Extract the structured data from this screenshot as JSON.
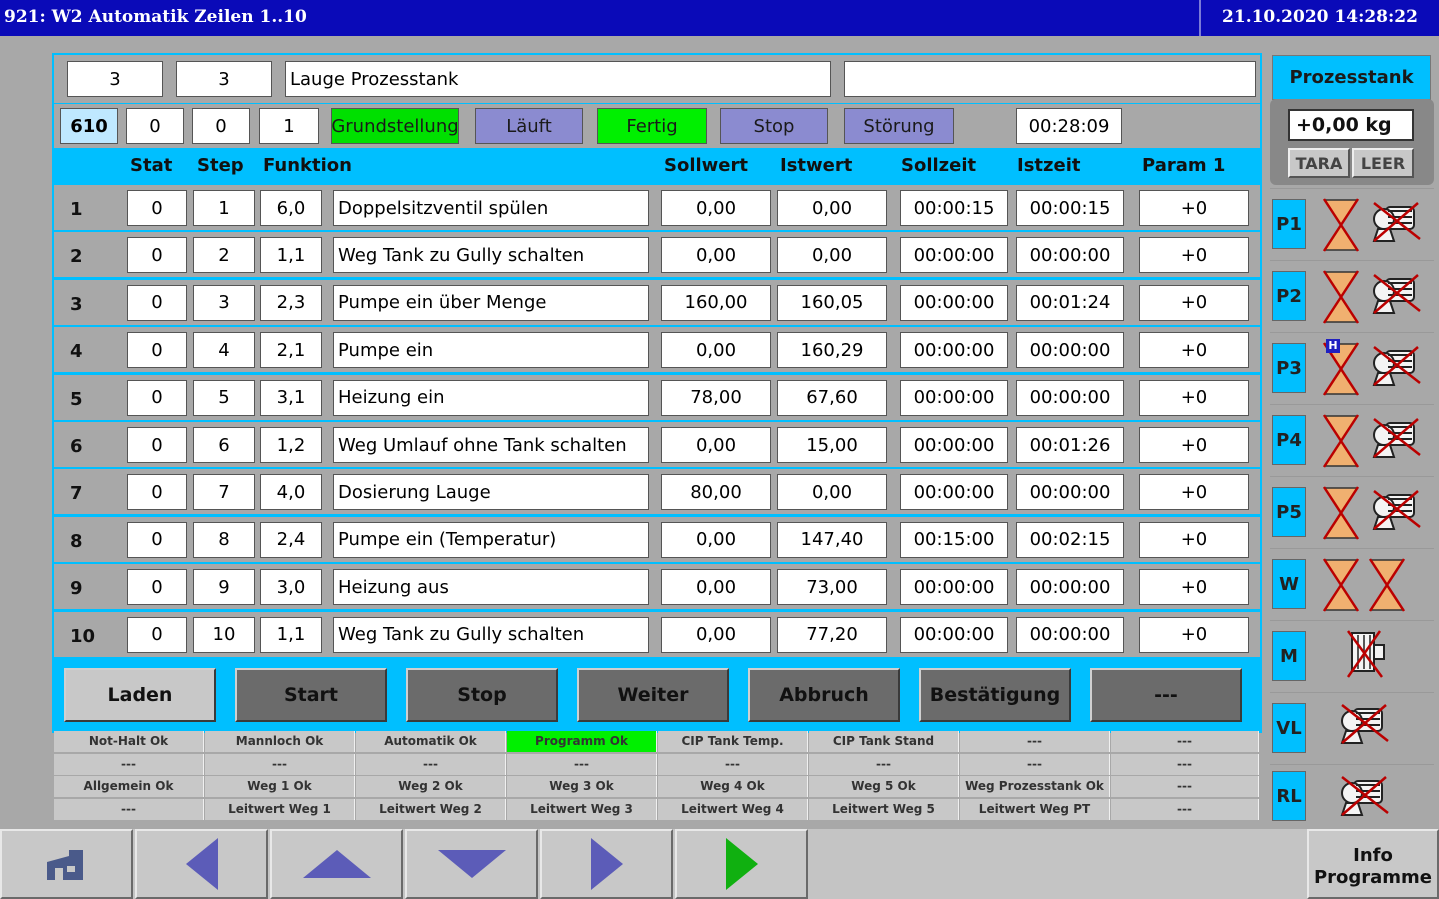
{
  "titlebar": {
    "title": "921: W2 Automatik Zeilen 1..10",
    "datetime": "21.10.2020 14:28:22"
  },
  "header": {
    "field1": "3",
    "field2": "3",
    "name": "Lauge Prozesstank",
    "extra": "",
    "program_no": "610",
    "v1": "0",
    "v2": "0",
    "v3": "1",
    "status_buttons": [
      {
        "label": "Grundstellung",
        "color": "#00e000"
      },
      {
        "label": "Läuft",
        "color": "#8b8bd0"
      },
      {
        "label": "Fertig",
        "color": "#00f000"
      },
      {
        "label": "Stop",
        "color": "#8b8bd0"
      },
      {
        "label": "Störung",
        "color": "#8b8bd0"
      }
    ],
    "runtime": "00:28:09"
  },
  "columns": {
    "stat": "Stat",
    "step": "Step",
    "funktion": "Funktion",
    "sollwert": "Sollwert",
    "istwert": "Istwert",
    "sollzeit": "Sollzeit",
    "istzeit": "Istzeit",
    "param1": "Param 1"
  },
  "rows": [
    {
      "num": "1",
      "stat": "0",
      "step": "1",
      "code": "6,0",
      "func": "Doppelsitzventil spülen",
      "soll": "0,00",
      "ist": "0,00",
      "sollzeit": "00:00:15",
      "istzeit": "00:00:15",
      "param": "+0"
    },
    {
      "num": "2",
      "stat": "0",
      "step": "2",
      "code": "1,1",
      "func": "Weg Tank zu Gully schalten",
      "soll": "0,00",
      "ist": "0,00",
      "sollzeit": "00:00:00",
      "istzeit": "00:00:00",
      "param": "+0"
    },
    {
      "num": "3",
      "stat": "0",
      "step": "3",
      "code": "2,3",
      "func": "Pumpe ein über Menge",
      "soll": "160,00",
      "ist": "160,05",
      "sollzeit": "00:00:00",
      "istzeit": "00:01:24",
      "param": "+0"
    },
    {
      "num": "4",
      "stat": "0",
      "step": "4",
      "code": "2,1",
      "func": "Pumpe ein",
      "soll": "0,00",
      "ist": "160,29",
      "sollzeit": "00:00:00",
      "istzeit": "00:00:00",
      "param": "+0"
    },
    {
      "num": "5",
      "stat": "0",
      "step": "5",
      "code": "3,1",
      "func": "Heizung ein",
      "soll": "78,00",
      "ist": "67,60",
      "sollzeit": "00:00:00",
      "istzeit": "00:00:00",
      "param": "+0"
    },
    {
      "num": "6",
      "stat": "0",
      "step": "6",
      "code": "1,2",
      "func": "Weg Umlauf ohne Tank schalten",
      "soll": "0,00",
      "ist": "15,00",
      "sollzeit": "00:00:00",
      "istzeit": "00:01:26",
      "param": "+0"
    },
    {
      "num": "7",
      "stat": "0",
      "step": "7",
      "code": "4,0",
      "func": "Dosierung Lauge",
      "soll": "80,00",
      "ist": "0,00",
      "sollzeit": "00:00:00",
      "istzeit": "00:00:00",
      "param": "+0"
    },
    {
      "num": "8",
      "stat": "0",
      "step": "8",
      "code": "2,4",
      "func": "Pumpe ein (Temperatur)",
      "soll": "0,00",
      "ist": "147,40",
      "sollzeit": "00:15:00",
      "istzeit": "00:02:15",
      "param": "+0"
    },
    {
      "num": "9",
      "stat": "0",
      "step": "9",
      "code": "3,0",
      "func": "Heizung aus",
      "soll": "0,00",
      "ist": "73,00",
      "sollzeit": "00:00:00",
      "istzeit": "00:00:00",
      "param": "+0"
    },
    {
      "num": "10",
      "stat": "0",
      "step": "10",
      "code": "1,1",
      "func": "Weg Tank zu Gully schalten",
      "soll": "0,00",
      "ist": "77,20",
      "sollzeit": "00:00:00",
      "istzeit": "00:00:00",
      "param": "+0"
    }
  ],
  "actions": [
    "Laden",
    "Start",
    "Stop",
    "Weiter",
    "Abbruch",
    "Bestätigung",
    "---"
  ],
  "status_grid": [
    [
      {
        "t": "Not-Halt Ok"
      },
      {
        "t": "Mannloch Ok"
      },
      {
        "t": "Automatik Ok"
      },
      {
        "t": "Programm Ok",
        "ok": true
      },
      {
        "t": "CIP Tank Temp."
      },
      {
        "t": "CIP Tank Stand"
      },
      {
        "t": "---"
      },
      {
        "t": "---"
      }
    ],
    [
      {
        "t": "---"
      },
      {
        "t": "---"
      },
      {
        "t": "---"
      },
      {
        "t": "---"
      },
      {
        "t": "---"
      },
      {
        "t": "---"
      },
      {
        "t": "---"
      },
      {
        "t": "---"
      }
    ],
    [
      {
        "t": "Allgemein Ok"
      },
      {
        "t": "Weg 1 Ok"
      },
      {
        "t": "Weg 2 Ok"
      },
      {
        "t": "Weg 3 Ok"
      },
      {
        "t": "Weg 4 Ok"
      },
      {
        "t": "Weg 5 Ok"
      },
      {
        "t": "Weg Prozesstank Ok"
      },
      {
        "t": "---"
      }
    ],
    [
      {
        "t": "---"
      },
      {
        "t": "Leitwert Weg 1"
      },
      {
        "t": "Leitwert Weg 2"
      },
      {
        "t": "Leitwert Weg 3"
      },
      {
        "t": "Leitwert Weg 4"
      },
      {
        "t": "Leitwert Weg 5"
      },
      {
        "t": "Leitwert Weg PT"
      },
      {
        "t": "---"
      }
    ]
  ],
  "tank": {
    "title": "Prozesstank",
    "weight": "+0,00 kg",
    "tara": "TARA",
    "leer": "LEER",
    "hand_badge": "H"
  },
  "paths": [
    "P1",
    "P2",
    "P3",
    "P4",
    "P5",
    "W",
    "M",
    "VL",
    "RL"
  ],
  "nav": {
    "info_line1": "Info",
    "info_line2": "Programme"
  }
}
